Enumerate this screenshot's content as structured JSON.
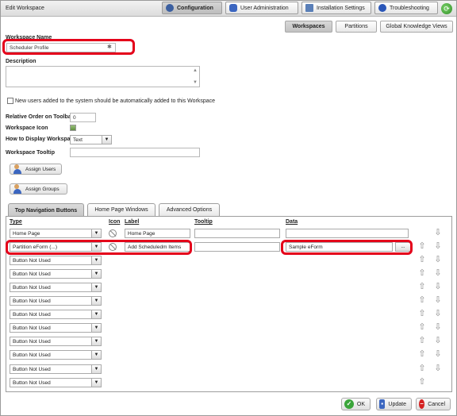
{
  "window": {
    "title": "Edit Workspace"
  },
  "top_tabs": [
    {
      "label": "Configuration",
      "icon": "gear-icon",
      "active": true
    },
    {
      "label": "User Administration",
      "icon": "user-icon",
      "active": false
    },
    {
      "label": "Installation Settings",
      "icon": "document-icon",
      "active": false
    },
    {
      "label": "Troubleshooting",
      "icon": "info-icon",
      "active": false
    }
  ],
  "sub_tabs": [
    {
      "label": "Workspaces",
      "active": true
    },
    {
      "label": "Partitions",
      "active": false
    },
    {
      "label": "Global Knowledge Views",
      "active": false
    }
  ],
  "form": {
    "workspace_name_label": "Workspace Name",
    "workspace_name_value": "Scheduler Profile",
    "required_mark": "✱",
    "description_label": "Description",
    "checkbox_label": "New users added to the system should be automatically added to this Workspace",
    "order_label": "Relative Order on Toolbar",
    "order_value": "0",
    "icon_label": "Workspace Icon",
    "display_label": "How to Display Workspace",
    "display_value": "Text",
    "tooltip_label": "Workspace Tooltip",
    "assign_users": "Assign Users",
    "assign_groups": "Assign Groups"
  },
  "lower_tabs": [
    {
      "label": "Top Navigation Buttons",
      "active": true
    },
    {
      "label": "Home Page Windows",
      "active": false
    },
    {
      "label": "Advanced Options",
      "active": false
    }
  ],
  "columns": {
    "type": "Type",
    "icon": "Icon",
    "label": "Label",
    "tooltip": "Tooltip",
    "data": "Data"
  },
  "rows": [
    {
      "type": "Home Page",
      "label": "Home Page",
      "data": ""
    },
    {
      "type": "Partition eForm (...)",
      "label": "Add Scheduledm Items",
      "data": "Sample eForm",
      "browse": "..."
    },
    {
      "type": "Button Not Used"
    },
    {
      "type": "Button Not Used"
    },
    {
      "type": "Button Not Used"
    },
    {
      "type": "Button Not Used"
    },
    {
      "type": "Button Not Used"
    },
    {
      "type": "Button Not Used"
    },
    {
      "type": "Button Not Used"
    },
    {
      "type": "Button Not Used"
    },
    {
      "type": "Button Not Used"
    },
    {
      "type": "Button Not Used"
    }
  ],
  "footer": {
    "ok": "OK",
    "update": "Update",
    "cancel": "Cancel"
  },
  "colors": {
    "highlight": "#e4001a",
    "ok_green": "#3aa53a",
    "cancel_red": "#d42020",
    "update_blue": "#3b66c0"
  }
}
